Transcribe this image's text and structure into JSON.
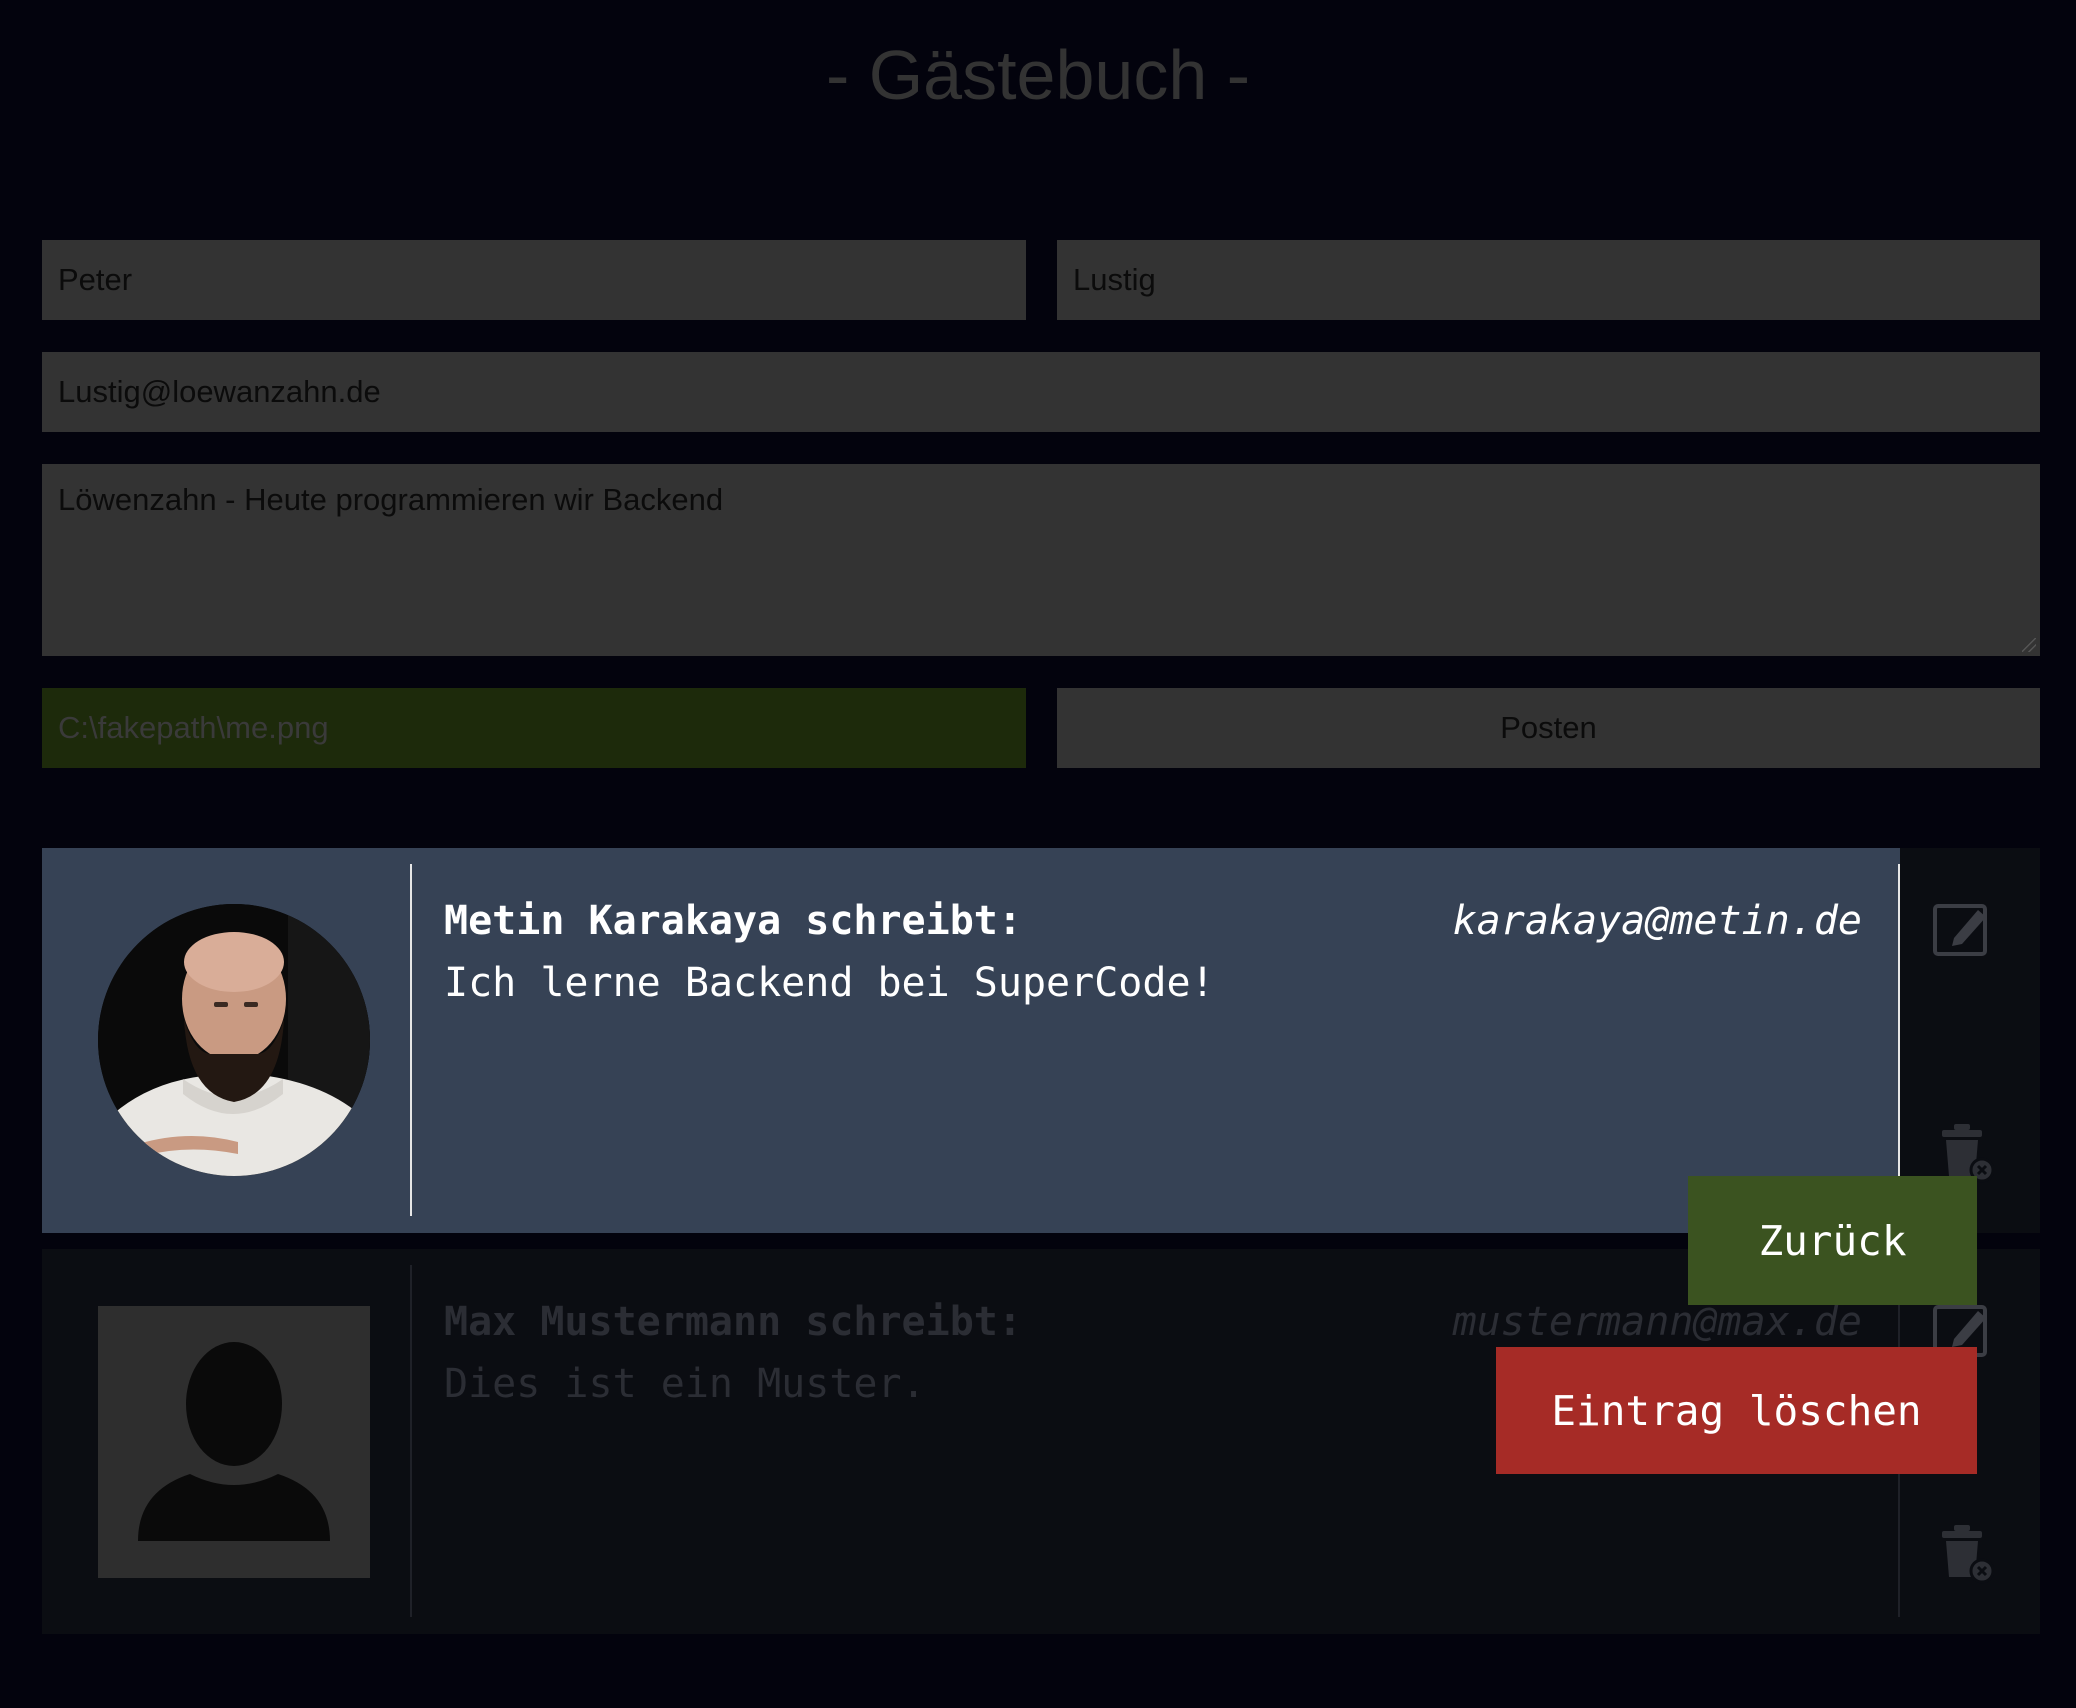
{
  "page": {
    "title": "- Gästebuch -"
  },
  "form": {
    "first_name": "Peter",
    "last_name": "Lustig",
    "email": "Lustig@loewanzahn.de",
    "message": "Löwenzahn - Heute programmieren wir Backend",
    "file": "C:\\fakepath\\me.png",
    "submit_label": "Posten"
  },
  "entries": [
    {
      "header": "Metin Karakaya schreibt:",
      "email": "karakaya@metin.de",
      "message": "Ich lerne Backend bei SuperCode!",
      "avatar": "photo-avatar"
    },
    {
      "header": "Max Mustermann schreibt:",
      "email": "mustermann@max.de",
      "message": "Dies ist ein Muster.",
      "avatar": "placeholder-avatar"
    }
  ],
  "overlay": {
    "back_label": "Zurück",
    "delete_label": "Eintrag löschen"
  },
  "colors": {
    "background": "#03030d",
    "field_bg": "#333333",
    "file_field_bg": "#1d2a0b",
    "active_entry_bg": "#364255",
    "muted_entry_bg": "#0b0d12",
    "back_button": "#3b5320",
    "delete_button": "#a62b26"
  },
  "icons": {
    "edit": "edit-icon",
    "delete": "trash-icon"
  }
}
